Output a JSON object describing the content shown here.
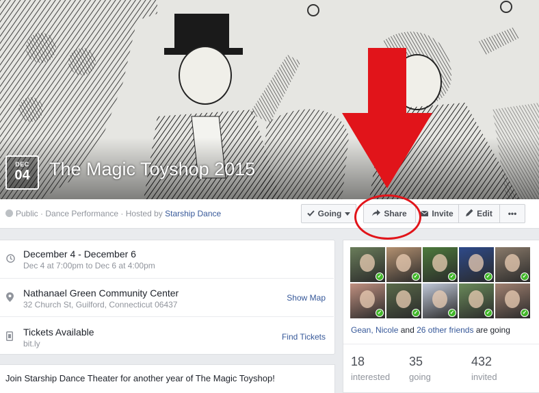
{
  "event": {
    "month": "DEC",
    "day": "04",
    "title": "The Magic Toyshop 2015",
    "privacy": "Public",
    "category": "Dance Performance",
    "hosted_by_label": "Hosted by",
    "host": "Starship Dance"
  },
  "actions": {
    "going": "Going",
    "share": "Share",
    "invite": "Invite",
    "edit": "Edit",
    "more": "•••"
  },
  "details": {
    "date_main": "December 4 - December 6",
    "date_sub": "Dec 4 at 7:00pm to Dec 6 at 4:00pm",
    "venue_main": "Nathanael Green Community Center",
    "venue_sub": "32 Church St, Guilford, Connecticut 06437",
    "show_map": "Show Map",
    "tickets_main": "Tickets Available",
    "tickets_sub": "bit.ly",
    "find_tickets": "Find Tickets"
  },
  "description": "Join Starship Dance Theater for another year of The Magic Toyshop!",
  "guests": {
    "names": "Gean, Nicole",
    "and": "and",
    "others": "26 other friends",
    "suffix": "are going",
    "stats": [
      {
        "num": "18",
        "label": "interested"
      },
      {
        "num": "35",
        "label": "going"
      },
      {
        "num": "432",
        "label": "invited"
      }
    ],
    "avatar_colors": [
      "#6a7d5a",
      "#b39070",
      "#4d7a3c",
      "#2e4a8a",
      "#8a7a6a",
      "#c09080",
      "#5a6a4a",
      "#c0c8d8",
      "#6a8a5a",
      "#a08070"
    ]
  },
  "colors": {
    "annotation_red": "#e1141a",
    "link": "#365899",
    "check_green": "#42b72a"
  }
}
